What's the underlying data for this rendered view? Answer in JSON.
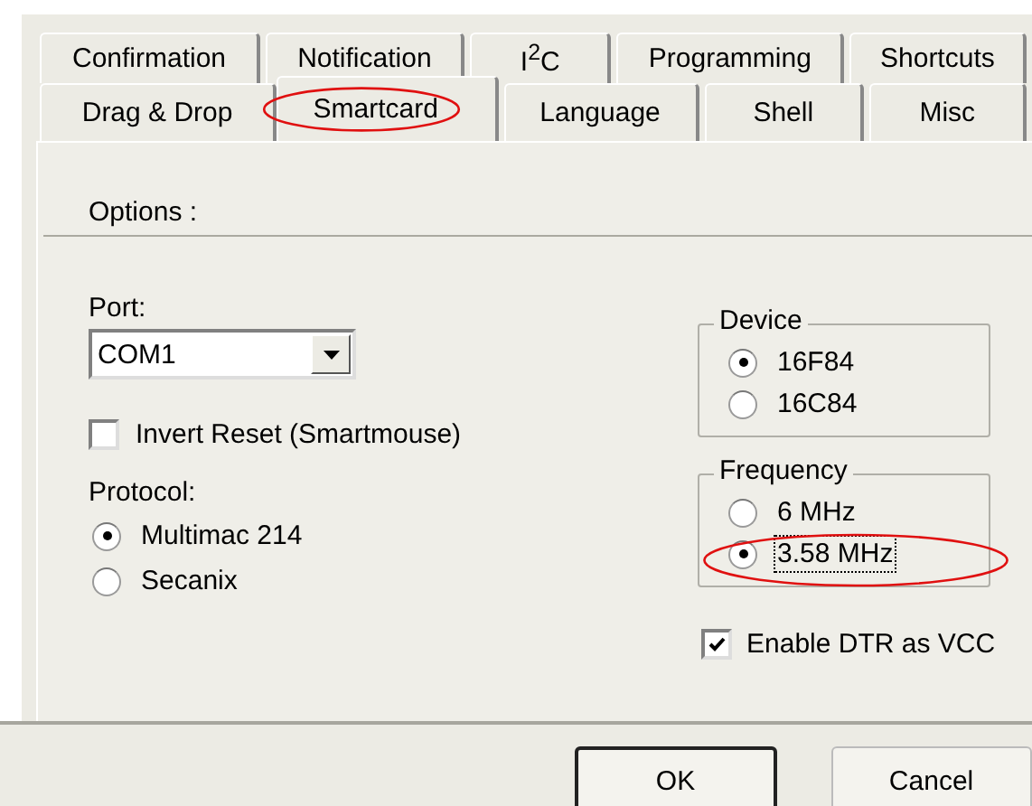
{
  "tabs": {
    "rows": [
      [
        {
          "label": "Confirmation",
          "selected": false,
          "highlighted": false
        },
        {
          "label": "Notification",
          "selected": false,
          "highlighted": false
        },
        {
          "label": "I$^{2}$C",
          "selected": false,
          "highlighted": false
        },
        {
          "label": "Programming",
          "selected": false,
          "highlighted": false
        },
        {
          "label": "Shortcuts",
          "selected": false,
          "highlighted": false
        }
      ],
      [
        {
          "label": "Drag & Drop",
          "selected": false,
          "highlighted": false
        },
        {
          "label": "Smartcard",
          "selected": true,
          "highlighted": true
        },
        {
          "label": "Language",
          "selected": false,
          "highlighted": false
        },
        {
          "label": "Shell",
          "selected": false,
          "highlighted": false
        },
        {
          "label": "Misc",
          "selected": false,
          "highlighted": false
        }
      ]
    ]
  },
  "options_title": "Options :",
  "port": {
    "label": "Port:",
    "value": "COM1"
  },
  "invert_reset": {
    "label": "Invert Reset (Smartmouse)",
    "checked": false
  },
  "protocol": {
    "label": "Protocol:",
    "options": [
      {
        "label": "Multimac 214",
        "selected": true
      },
      {
        "label": "Secanix",
        "selected": false
      }
    ]
  },
  "device": {
    "title": "Device",
    "options": [
      {
        "label": "16F84",
        "selected": true,
        "focused": false,
        "highlighted": false
      },
      {
        "label": "16C84",
        "selected": false,
        "focused": false,
        "highlighted": false
      }
    ]
  },
  "frequency": {
    "title": "Frequency",
    "options": [
      {
        "label": "6 MHz",
        "selected": false,
        "focused": false,
        "highlighted": false
      },
      {
        "label": "3.58 MHz",
        "selected": true,
        "focused": true,
        "highlighted": true
      }
    ]
  },
  "enable_dtr": {
    "label": "Enable DTR as VCC",
    "checked": true
  },
  "buttons": [
    {
      "label": "OK",
      "default": true
    },
    {
      "label": "Cancel",
      "default": false
    }
  ]
}
